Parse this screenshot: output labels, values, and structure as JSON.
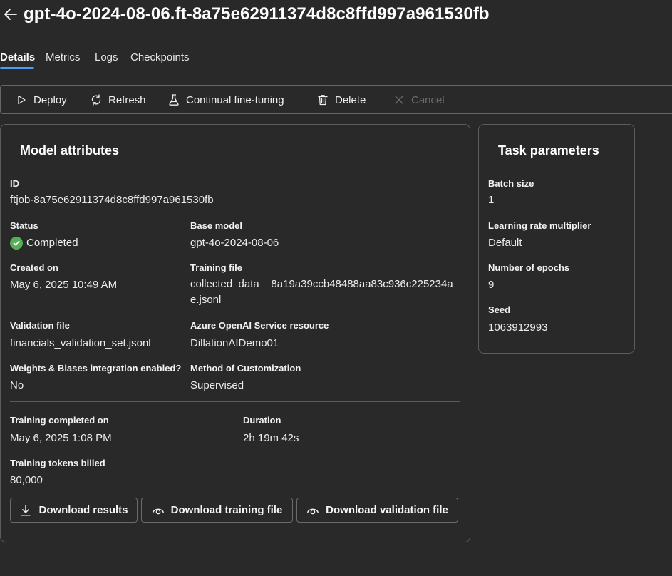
{
  "header": {
    "title": "gpt-4o-2024-08-06.ft-8a75e62911374d8c8ffd997a961530fb",
    "back_icon": "arrow-left-icon"
  },
  "tabs": [
    {
      "label": "Details",
      "active": true
    },
    {
      "label": "Metrics",
      "active": false
    },
    {
      "label": "Logs",
      "active": false
    },
    {
      "label": "Checkpoints",
      "active": false
    }
  ],
  "toolbar": {
    "deploy": "Deploy",
    "refresh": "Refresh",
    "continual": "Continual fine-tuning",
    "delete": "Delete",
    "cancel": "Cancel"
  },
  "model_attributes": {
    "title": "Model attributes",
    "id": {
      "label": "ID",
      "value": "ftjob-8a75e62911374d8c8ffd997a961530fb"
    },
    "status": {
      "label": "Status",
      "value": "Completed",
      "color": "#54b054"
    },
    "base_model": {
      "label": "Base model",
      "value": "gpt-4o-2024-08-06"
    },
    "created_on": {
      "label": "Created on",
      "value": "May 6, 2025 10:49 AM"
    },
    "training_file": {
      "label": "Training file",
      "value": "collected_data__8a19a39ccb48488aa83c936c225234ae.jsonl"
    },
    "validation_file": {
      "label": "Validation file",
      "value": "financials_validation_set.jsonl"
    },
    "resource": {
      "label": "Azure OpenAI Service resource",
      "value": "DillationAIDemo01"
    },
    "wandb": {
      "label": "Weights & Biases integration enabled?",
      "value": "No"
    },
    "method": {
      "label": "Method of Customization",
      "value": "Supervised"
    },
    "training_completed": {
      "label": "Training completed on",
      "value": "May 6, 2025 1:08 PM"
    },
    "duration": {
      "label": "Duration",
      "value": "2h 19m 42s"
    },
    "tokens_billed": {
      "label": "Training tokens billed",
      "value": "80,000"
    },
    "buttons": {
      "download_results": "Download results",
      "download_training": "Download training file",
      "download_validation": "Download validation file"
    }
  },
  "task_parameters": {
    "title": "Task parameters",
    "batch_size": {
      "label": "Batch size",
      "value": "1"
    },
    "learning_rate": {
      "label": "Learning rate multiplier",
      "value": "Default"
    },
    "epochs": {
      "label": "Number of epochs",
      "value": "9"
    },
    "seed": {
      "label": "Seed",
      "value": "1063912993"
    }
  },
  "colors": {
    "background": "#292929",
    "accent": "#479ef5",
    "success": "#54b054",
    "border": "#5c5c5c"
  }
}
